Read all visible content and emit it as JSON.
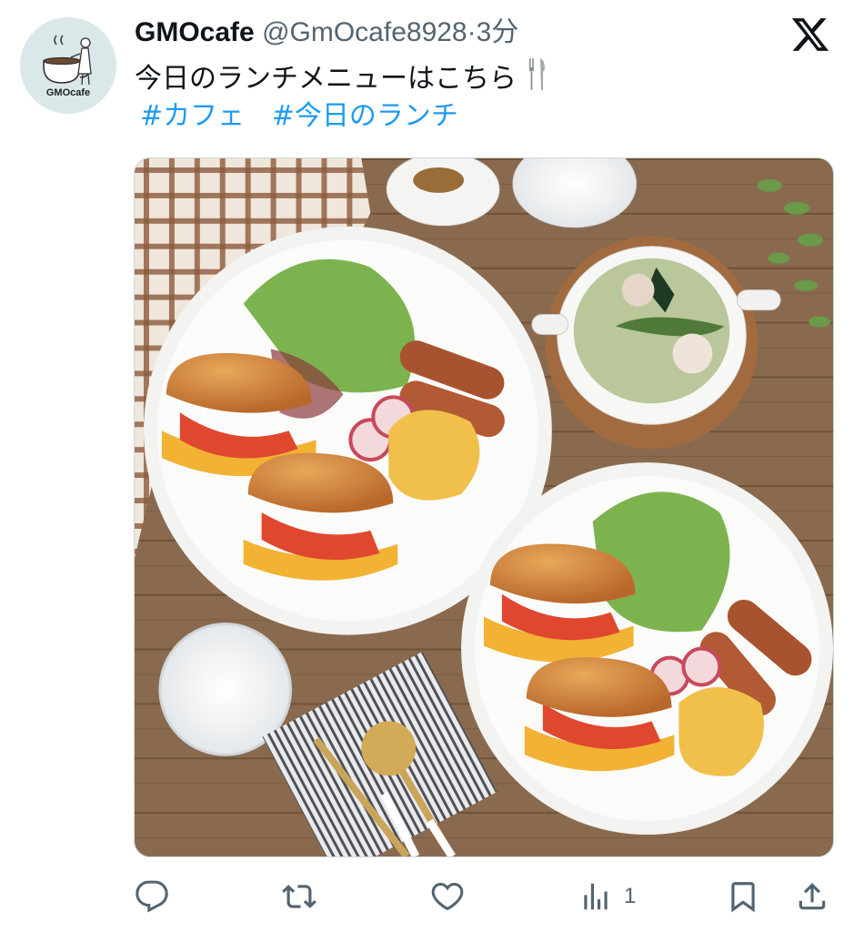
{
  "author": {
    "display_name": "GMOcafe",
    "handle": "@GmOcafe8928",
    "separator": "·",
    "time": "3分",
    "avatar_text": "GMOcafe"
  },
  "tweet": {
    "text": "今日のランチメニューはこちら",
    "emoji_icon": "fork-and-knife-icon",
    "hashtags": [
      "#カフェ",
      "#今日のランチ"
    ]
  },
  "media": {
    "alt": ""
  },
  "actions": {
    "reply_count": "",
    "retweet_count": "",
    "like_count": "",
    "views_count": "1"
  },
  "colors": {
    "link": "#1d9bf0",
    "secondary_text": "#536471",
    "primary_text": "#0f1419",
    "avatar_bg": "#dbe8ea"
  }
}
